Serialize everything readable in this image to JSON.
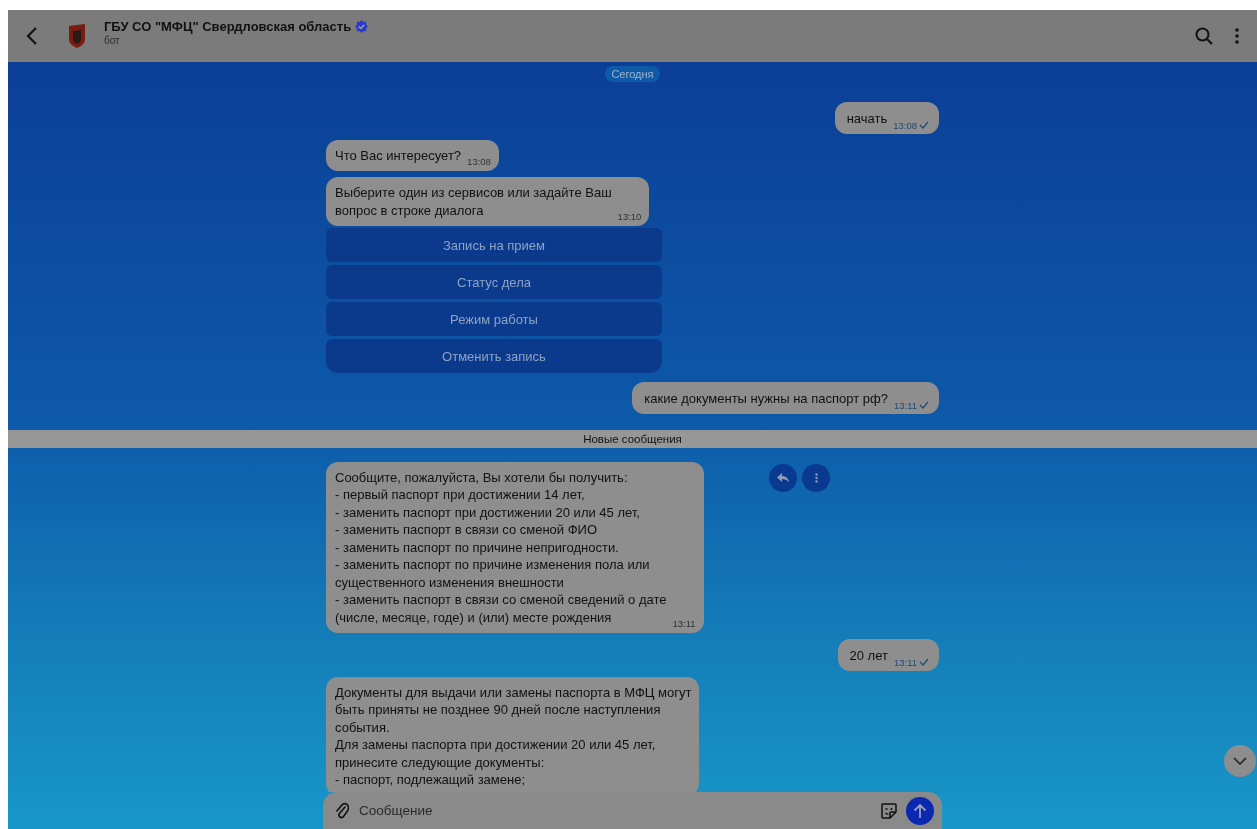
{
  "header": {
    "title": "ГБУ СО \"МФЦ\" Свердловская область",
    "verified": true,
    "subtitle": "бот"
  },
  "feed": [
    {
      "kind": "date",
      "text": "Сегодня"
    },
    {
      "kind": "outgoing",
      "text": "начать",
      "time": "13:08",
      "sent": true
    },
    {
      "kind": "incoming",
      "text": "Что Вас интересует?",
      "time": "13:08",
      "actions": false
    },
    {
      "kind": "incoming",
      "text": "Выберите один из сервисов или задайте Ваш\nвопрос в строке диалога",
      "time": "13:10",
      "actions": false
    },
    {
      "kind": "keyboard",
      "buttons": [
        "Запись на прием",
        "Статус дела",
        "Режим работы",
        "Отменить запись"
      ]
    },
    {
      "kind": "outgoing",
      "text": "какие документы нужны на паспорт рф?",
      "time": "13:11",
      "sent": true
    },
    {
      "kind": "divider",
      "text": "Новые сообщения"
    },
    {
      "kind": "incoming",
      "text": "Сообщите, пожалуйста, Вы хотели бы получить:\n- первый паспорт при достижении 14 лет,\n- заменить паспорт при достижении 20 или 45 лет,\n- заменить паспорт в связи со сменой ФИО\n- заменить паспорт по причине непригодности.\n- заменить паспорт по причине изменения пола или\nсущественного изменения внешности\n- заменить паспорт в связи со сменой сведений о дате\n(числе, месяце, годе) и (или) месте рождения",
      "time": "13:11",
      "actions": true
    },
    {
      "kind": "outgoing",
      "text": "20 лет",
      "time": "13:11",
      "sent": true
    },
    {
      "kind": "incoming",
      "text": "Документы для выдачи или замены паспорта в МФЦ могут\nбыть приняты не позднее 90 дней после наступления\nсобытия.\nДля замены паспорта при достижении 20 или 45 лет,\nпринесите следующие документы:\n- паспорт, подлежащий замене;",
      "actions": false
    }
  ],
  "composer": {
    "placeholder": "Сообщение"
  }
}
